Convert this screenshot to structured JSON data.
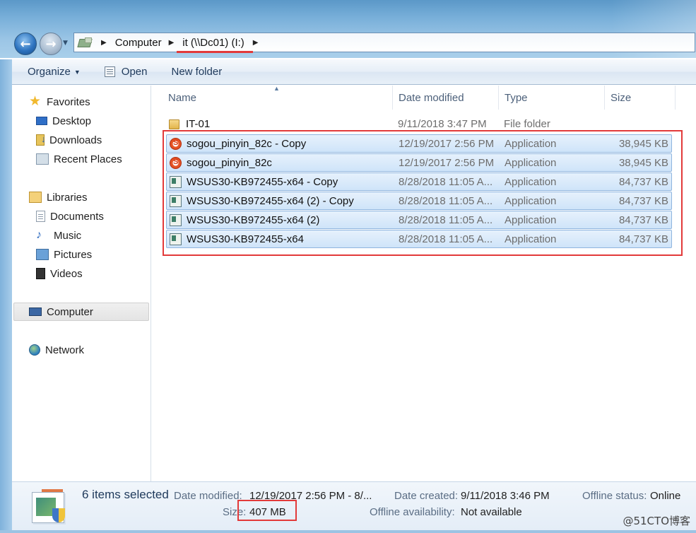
{
  "address": {
    "crumbs": [
      "Computer",
      "it (\\\\Dc01) (I:)"
    ]
  },
  "toolbar": {
    "organize_label": "Organize",
    "open_label": "Open",
    "new_folder_label": "New folder"
  },
  "sidebar": {
    "favorites": "Favorites",
    "desktop": "Desktop",
    "downloads": "Downloads",
    "recent": "Recent Places",
    "libraries": "Libraries",
    "documents": "Documents",
    "music": "Music",
    "pictures": "Pictures",
    "videos": "Videos",
    "computer": "Computer",
    "network": "Network"
  },
  "columns": {
    "name": "Name",
    "date": "Date modified",
    "type": "Type",
    "size": "Size"
  },
  "files": [
    {
      "name": "IT-01",
      "date": "9/11/2018 3:47 PM",
      "type": "File folder",
      "size": "",
      "icon": "folder-icon",
      "selected": false
    },
    {
      "name": "sogou_pinyin_82c - Copy",
      "date": "12/19/2017 2:56 PM",
      "type": "Application",
      "size": "38,945 KB",
      "icon": "sogou-app-icon",
      "selected": true
    },
    {
      "name": "sogou_pinyin_82c",
      "date": "12/19/2017 2:56 PM",
      "type": "Application",
      "size": "38,945 KB",
      "icon": "sogou-app-icon",
      "selected": true
    },
    {
      "name": "WSUS30-KB972455-x64 - Copy",
      "date": "8/28/2018 11:05 A...",
      "type": "Application",
      "size": "84,737 KB",
      "icon": "installer-app-icon",
      "selected": true
    },
    {
      "name": "WSUS30-KB972455-x64 (2) - Copy",
      "date": "8/28/2018 11:05 A...",
      "type": "Application",
      "size": "84,737 KB",
      "icon": "installer-app-icon",
      "selected": true
    },
    {
      "name": "WSUS30-KB972455-x64 (2)",
      "date": "8/28/2018 11:05 A...",
      "type": "Application",
      "size": "84,737 KB",
      "icon": "installer-app-icon",
      "selected": true
    },
    {
      "name": "WSUS30-KB972455-x64",
      "date": "8/28/2018 11:05 A...",
      "type": "Application",
      "size": "84,737 KB",
      "icon": "installer-app-icon",
      "selected": true
    }
  ],
  "details": {
    "count": "6 items selected",
    "modified_label": "Date modified:",
    "modified_value": "12/19/2017 2:56 PM - 8/...",
    "size_label": "Size:",
    "size_value": "407 MB",
    "created_label": "Date created:",
    "created_value": "9/11/2018 3:46 PM",
    "availability_label": "Offline availability:",
    "availability_value": "Not available",
    "offline_label": "Offline status:",
    "offline_value": "Online"
  },
  "watermark": "@51CTO博客",
  "colors": {
    "highlight_red": "#e23a3a",
    "selection": "#cfe4f9"
  }
}
